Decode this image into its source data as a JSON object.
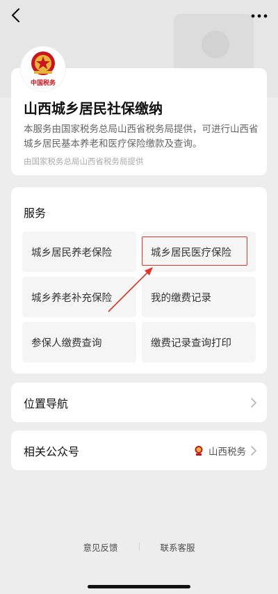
{
  "intro": {
    "title": "山西城乡居民社保缴纳",
    "description": "本服务由国家税务总局山西省税务局提供，可进行山西省城乡居民基本养老和医疗保险缴款及查询。",
    "provider": "由国家税务总局山西省税务局提供",
    "logo_text": "中国税务"
  },
  "services": {
    "title": "服务",
    "items": [
      {
        "label": "城乡居民养老保险"
      },
      {
        "label": "城乡居民医疗保险"
      },
      {
        "label": "城乡养老补充保险"
      },
      {
        "label": "我的缴费记录"
      },
      {
        "label": "参保人缴费查询"
      },
      {
        "label": "缴费记录查询打印"
      }
    ],
    "highlighted": "城乡居民医疗保险"
  },
  "navigation": {
    "label": "位置导航"
  },
  "account": {
    "label": "相关公众号",
    "value": "山西税务"
  },
  "footer": {
    "feedback": "意见反馈",
    "contact": "联系客服"
  },
  "colors": {
    "highlight": "#e0342b",
    "emblem": "#c8161e"
  },
  "icons": [
    "back-arrow-icon",
    "more-dots-icon",
    "chevron-right-icon",
    "tax-emblem-icon"
  ]
}
